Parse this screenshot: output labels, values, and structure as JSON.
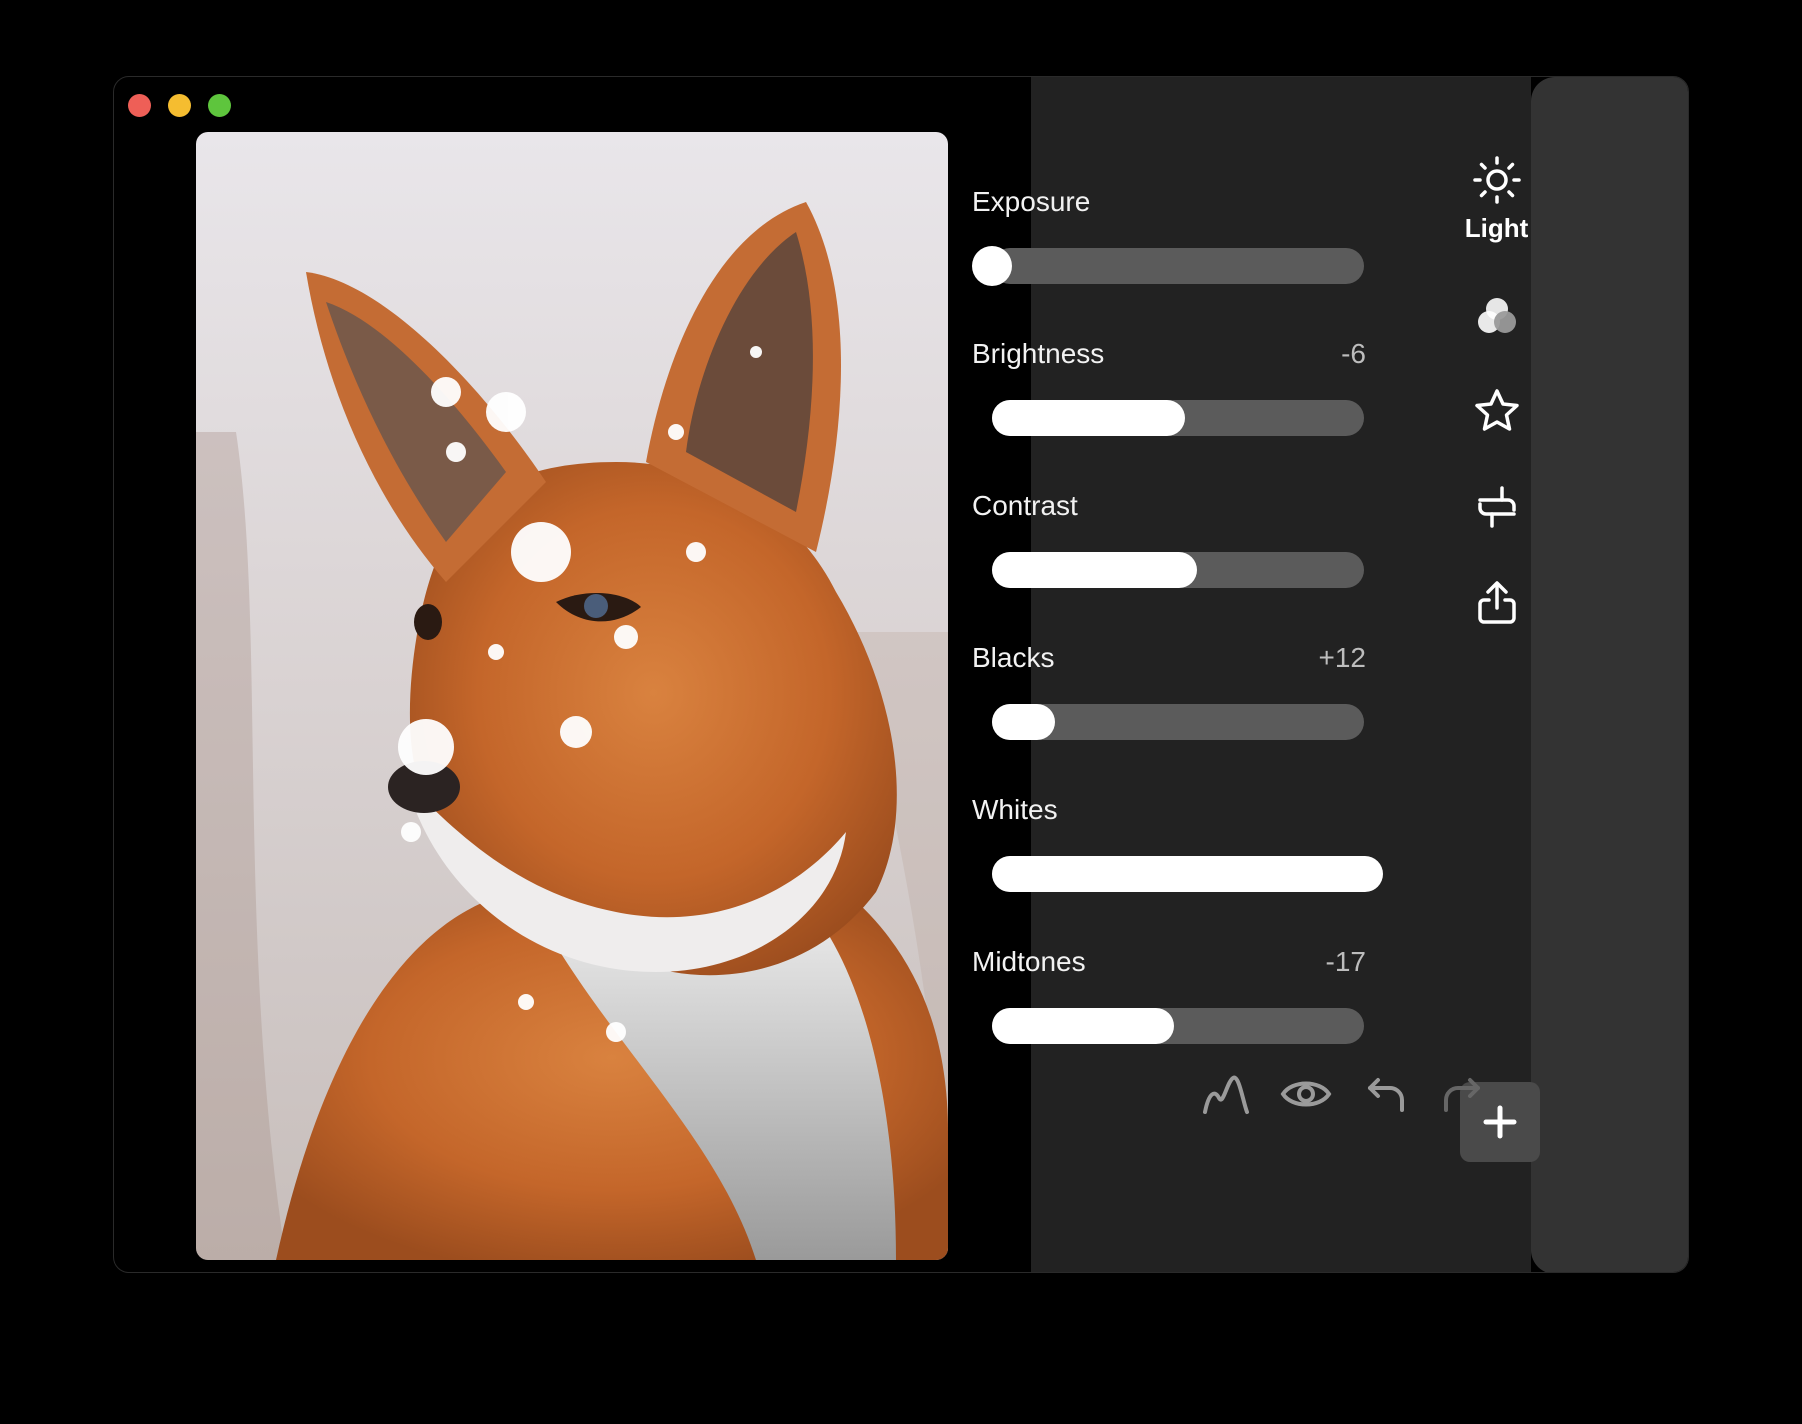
{
  "window": {
    "controls": [
      "close",
      "minimize",
      "maximize"
    ]
  },
  "photo": {
    "icon": "fox-photo"
  },
  "adjustments": [
    {
      "id": "exposure",
      "label": "Exposure",
      "value": "",
      "level": 0.0
    },
    {
      "id": "brightness",
      "label": "Brightness",
      "value": "-6",
      "level": 0.52
    },
    {
      "id": "contrast",
      "label": "Contrast",
      "value": "",
      "level": 0.55
    },
    {
      "id": "blacks",
      "label": "Blacks",
      "value": "+12",
      "level": 0.17
    },
    {
      "id": "whites",
      "label": "Whites",
      "value": "",
      "level": 1.05
    },
    {
      "id": "midtones",
      "label": "Midtones",
      "value": "-17",
      "level": 0.49
    }
  ],
  "rail": {
    "items": [
      {
        "id": "light",
        "icon": "sun-icon",
        "label": "Light",
        "active": true
      },
      {
        "id": "color",
        "icon": "color-circles-icon",
        "label": ""
      },
      {
        "id": "effects",
        "icon": "star-icon",
        "label": ""
      },
      {
        "id": "crop",
        "icon": "crop-rotate-icon",
        "label": ""
      },
      {
        "id": "export",
        "icon": "share-icon",
        "label": ""
      }
    ],
    "add_icon": "plus-icon"
  },
  "toolbar": {
    "tools": [
      "curve-icon",
      "eye-icon",
      "undo-icon",
      "redo-icon"
    ]
  },
  "colors": {
    "panel": "#222222",
    "rail": "#333333",
    "track": "#5b5b5b",
    "fill": "#ffffff"
  }
}
